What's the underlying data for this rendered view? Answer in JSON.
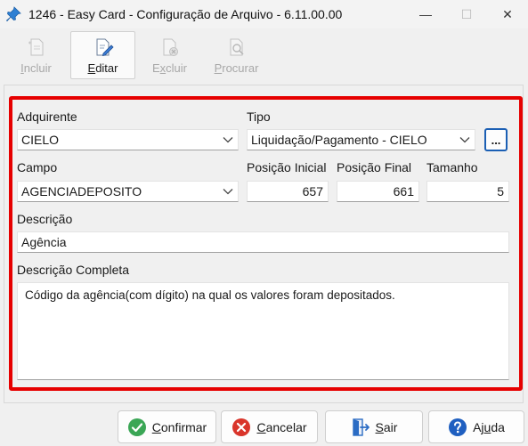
{
  "window": {
    "title": "1246 - Easy Card - Configuração de Arquivo - 6.11.00.00",
    "minimize_glyph": "—",
    "maximize_glyph": "☐",
    "close_glyph": "✕"
  },
  "toolbar": {
    "incluir": {
      "first": "I",
      "rest": "ncluir",
      "enabled": false,
      "icon": "add-document-icon"
    },
    "editar": {
      "first": "E",
      "rest": "ditar",
      "enabled": true,
      "icon": "edit-document-icon"
    },
    "excluir": {
      "pre": "E",
      "first": "x",
      "rest": "cluir",
      "enabled": false,
      "icon": "delete-document-icon"
    },
    "procurar": {
      "first": "P",
      "rest": "rocurar",
      "enabled": false,
      "icon": "search-document-icon"
    }
  },
  "form": {
    "adquirente": {
      "label": "Adquirente",
      "value": "CIELO"
    },
    "tipo": {
      "label": "Tipo",
      "value": "Liquidação/Pagamento - CIELO"
    },
    "ellipsis_label": "...",
    "campo": {
      "label": "Campo",
      "value": "AGENCIADEPOSITO"
    },
    "posicao_inicial": {
      "label": "Posição Inicial",
      "value": "657"
    },
    "posicao_final": {
      "label": "Posição Final",
      "value": "661"
    },
    "tamanho": {
      "label": "Tamanho",
      "value": "5"
    },
    "descricao": {
      "label": "Descrição",
      "value": "Agência"
    },
    "descricao_completa": {
      "label": "Descrição Completa",
      "value": "Código da agência(com dígito) na qual os valores foram depositados."
    }
  },
  "buttons": {
    "confirmar": {
      "first": "C",
      "rest": "onfirmar",
      "icon": "check-circle-icon",
      "color": "#3aa655"
    },
    "cancelar": {
      "first": "C",
      "rest": "ancelar",
      "icon": "x-circle-icon",
      "color": "#d9352b"
    },
    "sair": {
      "first": "S",
      "rest": "air",
      "icon": "exit-door-icon",
      "color": "#2b6cc4"
    },
    "ajuda": {
      "pre": "Aj",
      "first": "u",
      "rest": "da",
      "icon": "help-circle-icon",
      "color": "#1f5fc0"
    }
  },
  "colors": {
    "highlight_border": "#e60000",
    "focus_border": "#1b5fb4"
  }
}
